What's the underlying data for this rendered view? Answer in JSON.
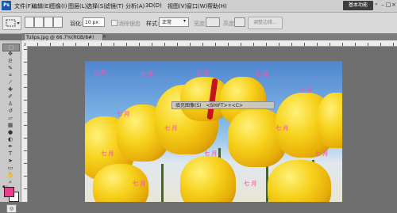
{
  "menubar": {
    "logo": "Ps",
    "items": [
      "文件(F)",
      "编辑(E)",
      "图像(I)",
      "图层(L)",
      "选择(S)",
      "滤镜(T)",
      "分析(A)",
      "3D(D)",
      "视图(V)",
      "窗口(W)",
      "帮助(H)"
    ],
    "zoom_value": "66.7",
    "workspace_button": "基本功能",
    "more": "»",
    "window_buttons": [
      "–",
      "□",
      "×"
    ]
  },
  "options": {
    "feather_label": "羽化:",
    "feather_value": "10 px",
    "antialias_label": "消除锯齿",
    "style_label": "样式:",
    "style_value": "正常",
    "width_label": "宽度:",
    "height_label": "高度:",
    "refine_edge_label": "调整边缘..."
  },
  "document": {
    "tab_title": "Tulips.jpg @ 66.7%(RGB/8#)",
    "tab_close": "×"
  },
  "tooltip": {
    "text": "填充图像(S)",
    "shortcut": "<SHIFT>+<C>"
  },
  "watermark": "七 月",
  "colors": {
    "foreground": "#ee3c8d",
    "background": "#ffffff"
  },
  "tools": [
    "marquee-tool",
    "move-tool",
    "lasso-tool",
    "quick-select-tool",
    "crop-tool",
    "eyedropper-tool",
    "healing-brush-tool",
    "brush-tool",
    "clone-stamp-tool",
    "history-brush-tool",
    "eraser-tool",
    "gradient-tool",
    "blur-tool",
    "dodge-tool",
    "pen-tool",
    "type-tool",
    "path-select-tool",
    "shape-tool",
    "3d-rotate-tool",
    "3d-orbit-tool",
    "hand-tool",
    "zoom-tool"
  ]
}
